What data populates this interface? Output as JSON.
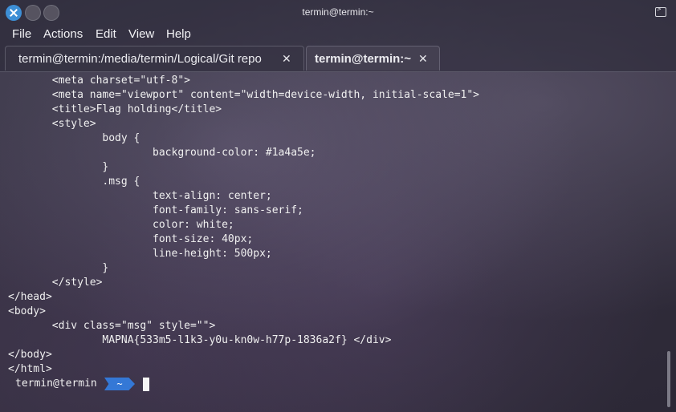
{
  "window": {
    "title": "termin@termin:~"
  },
  "menu": [
    "File",
    "Actions",
    "Edit",
    "View",
    "Help"
  ],
  "tabs": [
    {
      "label": "termin@termin:/media/termin/Logical/Git repo"
    },
    {
      "label": "termin@termin:~"
    }
  ],
  "tab_close_glyph": "✕",
  "terminal": {
    "lines": [
      "       <meta charset=\"utf-8\">",
      "       <meta name=\"viewport\" content=\"width=device-width, initial-scale=1\">",
      "       <title>Flag holding</title>",
      "       <style>",
      "               body {",
      "                       background-color: #1a4a5e;",
      "               }",
      "               .msg {",
      "                       text-align: center;",
      "                       font-family: sans-serif;",
      "                       color: white;",
      "                       font-size: 40px;",
      "                       line-height: 500px;",
      "               }",
      "       </style>",
      "</head>",
      "<body>",
      "       <div class=\"msg\" style=\"\">",
      "               MAPNA{533m5-l1k3-y0u-kn0w-h77p-1836a2f} </div>",
      "</body>",
      "</html>"
    ],
    "prompt_user": "termin@termin",
    "prompt_dir": "~"
  },
  "colors": {
    "accent": "#3d8fd6",
    "prompt_segment": "#3478d6",
    "text": "#f0f0f0"
  },
  "icons": {
    "close": "close-icon",
    "minimize": "minimize-icon",
    "maximize": "maximize-icon",
    "terminal": "terminal-icon"
  }
}
